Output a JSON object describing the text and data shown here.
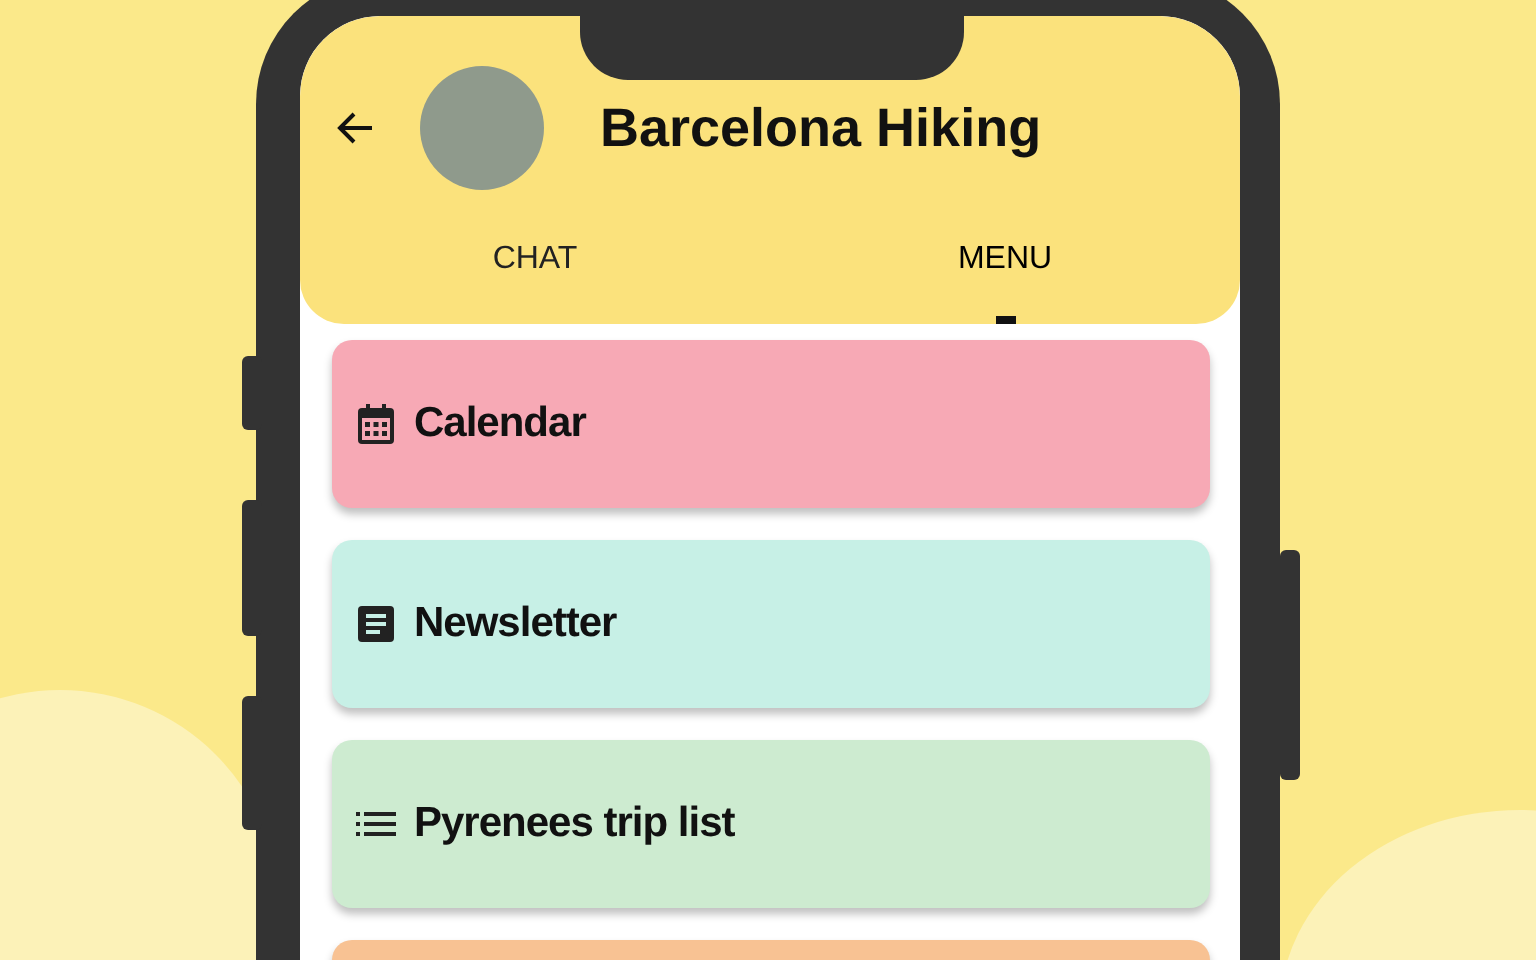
{
  "header": {
    "title": "Barcelona Hiking"
  },
  "tabs": [
    {
      "label": "CHAT",
      "selected": false
    },
    {
      "label": "MENU",
      "selected": true
    }
  ],
  "menu_items": [
    {
      "kind": "calendar",
      "label": "Calendar",
      "color": "#f7a9b5"
    },
    {
      "kind": "document",
      "label": "Newsletter",
      "color": "#c7f0e6"
    },
    {
      "kind": "list",
      "label": "Pyrenees trip list",
      "color": "#cdebd0"
    },
    {
      "kind": "blank",
      "color": "#f8c293"
    }
  ]
}
